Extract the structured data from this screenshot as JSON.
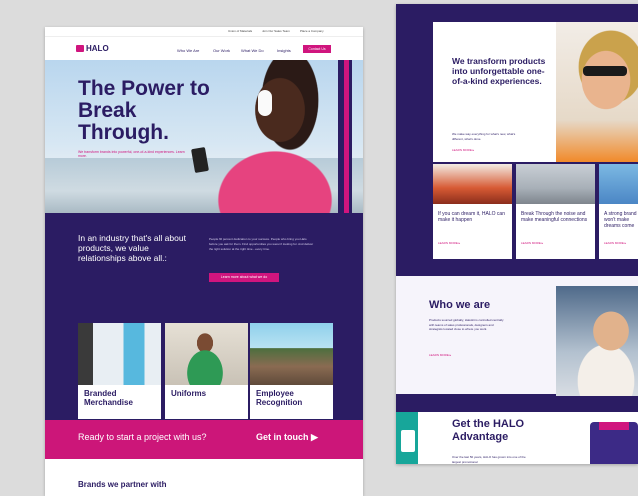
{
  "left_page": {
    "utility_links": [
      "Union of Materials",
      "Join Our Sales Team",
      "Place a Company"
    ],
    "logo": "HALO",
    "nav": [
      "Who We Are",
      "Our Work",
      "What We Do",
      "Insights"
    ],
    "nav_cta": "Contact Us",
    "hero": {
      "headline": "The Power to Break Through.",
      "tagline": "We transform brands into powerful, one-of-a-kind experiences. Learn more."
    },
    "intro": {
      "lead": "In an industry that's all about products, we value relationships above all.:",
      "paragraph": "People fill percent dedication to your success. People who bring you Halo before you ask for them. Find opportunities you weren't looking for. And deliver the right solution at the right time - every time.",
      "cta": "Learn more about what we do"
    },
    "cards": [
      {
        "label": "Branded Merchandise"
      },
      {
        "label": "Uniforms"
      },
      {
        "label": "Employee Recognition"
      }
    ],
    "strip": {
      "text": "Ready to start a project with us?",
      "cta": "Get in touch ▶"
    },
    "brands_heading": "Brands we partner with"
  },
  "right_page": {
    "hero": {
      "headline": "We transform products into unforgettable one-of-a-kind experiences.",
      "sub": "We make way everything for what's new, what's different, what's done.",
      "link": "LEARN MORE ▸"
    },
    "tiles": [
      {
        "title": "If you can dream it, HALO can make it happen",
        "link": "LEARN MORE ▸"
      },
      {
        "title": "Break Through the noise and make meaningful connections",
        "link": "LEARN MORE ▸"
      },
      {
        "title": "A strong brand won't make dreams come",
        "link": "LEARN MORE ▸"
      }
    ],
    "who": {
      "heading": "Who we are",
      "paragraph": "Products sourced globally, HaloHit is controlled centrally with teams of sales professionals, designers and strategists located close to where you work.",
      "link": "LEARN MORE ▸"
    },
    "advantage": {
      "heading": "Get the HALO Advantage",
      "paragraph": "Over the last 50 years, HALO has grown into one of the largest promotional"
    }
  },
  "colors": {
    "brand_navy": "#2b1c63",
    "brand_magenta": "#d0157e"
  }
}
